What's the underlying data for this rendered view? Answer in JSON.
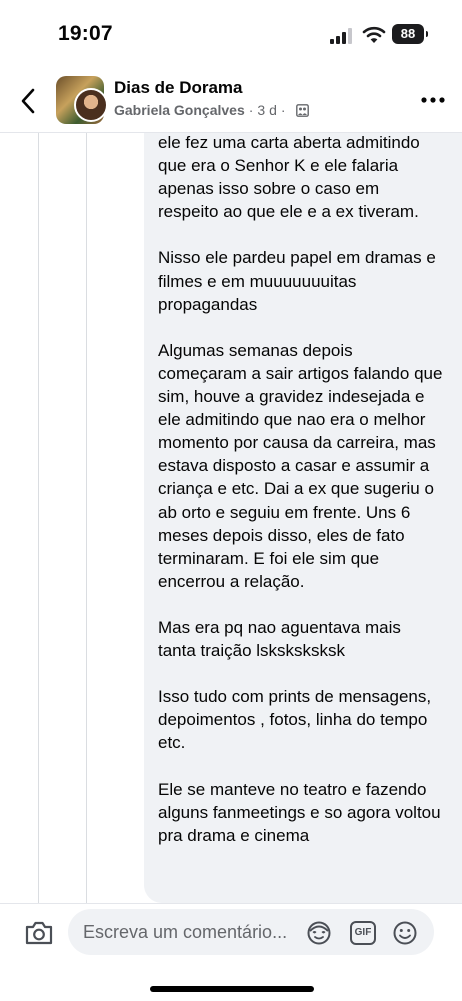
{
  "status_bar": {
    "time": "19:07",
    "battery": "88"
  },
  "header": {
    "group_name": "Dias de Dorama",
    "author": "Gabriela Gonçalves",
    "separator": "·",
    "age": "3 d",
    "icons": [
      "back-arrow-icon",
      "group-audience-icon",
      "more-dots-icon"
    ]
  },
  "comment": {
    "paragraphs": [
      "ele fez uma carta aberta admitindo que era o Senhor K e ele falaria apenas isso sobre o caso em respeito ao que ele e a ex tiveram.",
      "Nisso ele pardeu papel em dramas e filmes e em muuuuuuuitas propagandas",
      "Algumas semanas depois começaram a sair artigos falando que sim, houve a gravidez indesejada e ele admitindo que nao era o melhor momento por causa da carreira, mas estava disposto a casar e assumir a criança e etc. Dai a ex que sugeriu o ab orto e seguiu em frente. Uns 6 meses depois disso, eles de fato terminaram. E foi ele sim que encerrou a relação.",
      "Mas era pq nao aguentava mais tanta traição lsksksksksk",
      "Isso tudo com prints de mensagens, depoimentos , fotos, linha do tempo etc.",
      "Ele se manteve no teatro e fazendo alguns fanmeetings e so agora voltou pra drama e cinema"
    ]
  },
  "composer": {
    "placeholder": "Escreva um comentário...",
    "gif_label": "GIF",
    "icons": [
      "camera-icon",
      "avatar-sticker-icon",
      "gif-icon",
      "emoji-icon"
    ]
  }
}
